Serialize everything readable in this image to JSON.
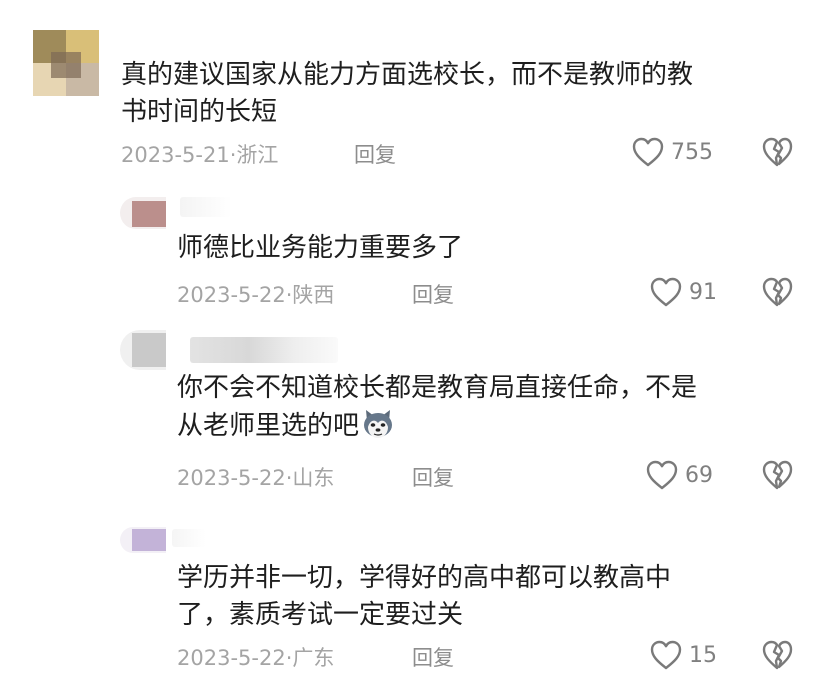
{
  "comments": [
    {
      "text_lines": [
        "真的建议国家从能力方面选校长，而不是教师的教",
        "书时间的长短"
      ],
      "date": "2023-5-21",
      "location": "浙江",
      "reply_label": "回复",
      "likes": "755",
      "has_username": false
    },
    {
      "text_lines": [
        "师德比业务能力重要多了"
      ],
      "date": "2023-5-22",
      "location": "陕西",
      "reply_label": "回复",
      "likes": "91",
      "has_username": true
    },
    {
      "text_lines": [
        "你不会不知道校长都是教育局直接任命，不是",
        "从老师里选的吧"
      ],
      "emoji": "husky-dog-emoji",
      "date": "2023-5-22",
      "location": "山东",
      "reply_label": "回复",
      "likes": "69",
      "has_username": true
    },
    {
      "text_lines": [
        "学历并非一切，学得好的高中都可以教高中",
        "了，素质考试一定要过关"
      ],
      "date": "2023-5-22",
      "location": "广东",
      "reply_label": "回复",
      "likes": "15",
      "has_username": true
    }
  ],
  "separator": "·",
  "icons": {
    "like": "heart-outline-icon",
    "dislike": "broken-heart-icon"
  },
  "colors": {
    "text": "#1e1e1e",
    "meta": "#a4a4a4",
    "icon": "#7a7a7a"
  }
}
